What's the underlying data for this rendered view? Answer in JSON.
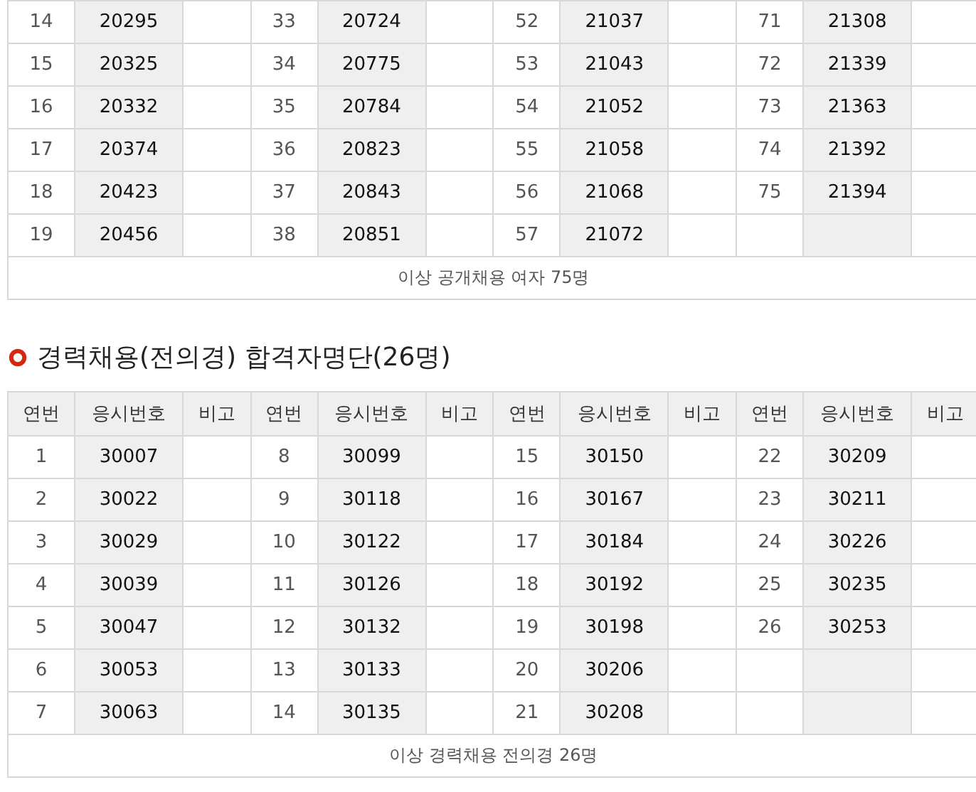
{
  "female_table": {
    "rows": [
      {
        "entries": [
          {
            "no": "14",
            "exam_no": "20295"
          },
          {
            "no": "33",
            "exam_no": "20724"
          },
          {
            "no": "52",
            "exam_no": "21037"
          },
          {
            "no": "71",
            "exam_no": "21308"
          }
        ]
      },
      {
        "entries": [
          {
            "no": "15",
            "exam_no": "20325"
          },
          {
            "no": "34",
            "exam_no": "20775"
          },
          {
            "no": "53",
            "exam_no": "21043"
          },
          {
            "no": "72",
            "exam_no": "21339"
          }
        ]
      },
      {
        "entries": [
          {
            "no": "16",
            "exam_no": "20332"
          },
          {
            "no": "35",
            "exam_no": "20784"
          },
          {
            "no": "54",
            "exam_no": "21052"
          },
          {
            "no": "73",
            "exam_no": "21363"
          }
        ]
      },
      {
        "entries": [
          {
            "no": "17",
            "exam_no": "20374"
          },
          {
            "no": "36",
            "exam_no": "20823"
          },
          {
            "no": "55",
            "exam_no": "21058"
          },
          {
            "no": "74",
            "exam_no": "21392"
          }
        ]
      },
      {
        "entries": [
          {
            "no": "18",
            "exam_no": "20423"
          },
          {
            "no": "37",
            "exam_no": "20843"
          },
          {
            "no": "56",
            "exam_no": "21068"
          },
          {
            "no": "75",
            "exam_no": "21394"
          }
        ]
      },
      {
        "entries": [
          {
            "no": "19",
            "exam_no": "20456"
          },
          {
            "no": "38",
            "exam_no": "20851"
          },
          {
            "no": "57",
            "exam_no": "21072"
          }
        ]
      }
    ],
    "footer": "이상 공개채용 여자 75명"
  },
  "career_section": {
    "title": "경력채용(전의경) 합격자명단(26명)",
    "columns": [
      "연번",
      "응시번호",
      "비고",
      "연번",
      "응시번호",
      "비고",
      "연번",
      "응시번호",
      "비고",
      "연번",
      "응시번호",
      "비고"
    ],
    "rows": [
      {
        "entries": [
          {
            "no": "1",
            "exam_no": "30007"
          },
          {
            "no": "8",
            "exam_no": "30099"
          },
          {
            "no": "15",
            "exam_no": "30150"
          },
          {
            "no": "22",
            "exam_no": "30209"
          }
        ]
      },
      {
        "entries": [
          {
            "no": "2",
            "exam_no": "30022"
          },
          {
            "no": "9",
            "exam_no": "30118"
          },
          {
            "no": "16",
            "exam_no": "30167"
          },
          {
            "no": "23",
            "exam_no": "30211"
          }
        ]
      },
      {
        "entries": [
          {
            "no": "3",
            "exam_no": "30029"
          },
          {
            "no": "10",
            "exam_no": "30122"
          },
          {
            "no": "17",
            "exam_no": "30184"
          },
          {
            "no": "24",
            "exam_no": "30226"
          }
        ]
      },
      {
        "entries": [
          {
            "no": "4",
            "exam_no": "30039"
          },
          {
            "no": "11",
            "exam_no": "30126"
          },
          {
            "no": "18",
            "exam_no": "30192"
          },
          {
            "no": "25",
            "exam_no": "30235"
          }
        ]
      },
      {
        "entries": [
          {
            "no": "5",
            "exam_no": "30047"
          },
          {
            "no": "12",
            "exam_no": "30132"
          },
          {
            "no": "19",
            "exam_no": "30198"
          },
          {
            "no": "26",
            "exam_no": "30253"
          }
        ]
      },
      {
        "entries": [
          {
            "no": "6",
            "exam_no": "30053"
          },
          {
            "no": "13",
            "exam_no": "30133"
          },
          {
            "no": "20",
            "exam_no": "30206"
          }
        ]
      },
      {
        "entries": [
          {
            "no": "7",
            "exam_no": "30063"
          },
          {
            "no": "14",
            "exam_no": "30135"
          },
          {
            "no": "21",
            "exam_no": "30208"
          }
        ]
      }
    ],
    "footer": "이상 경력채용 전의경 26명"
  }
}
